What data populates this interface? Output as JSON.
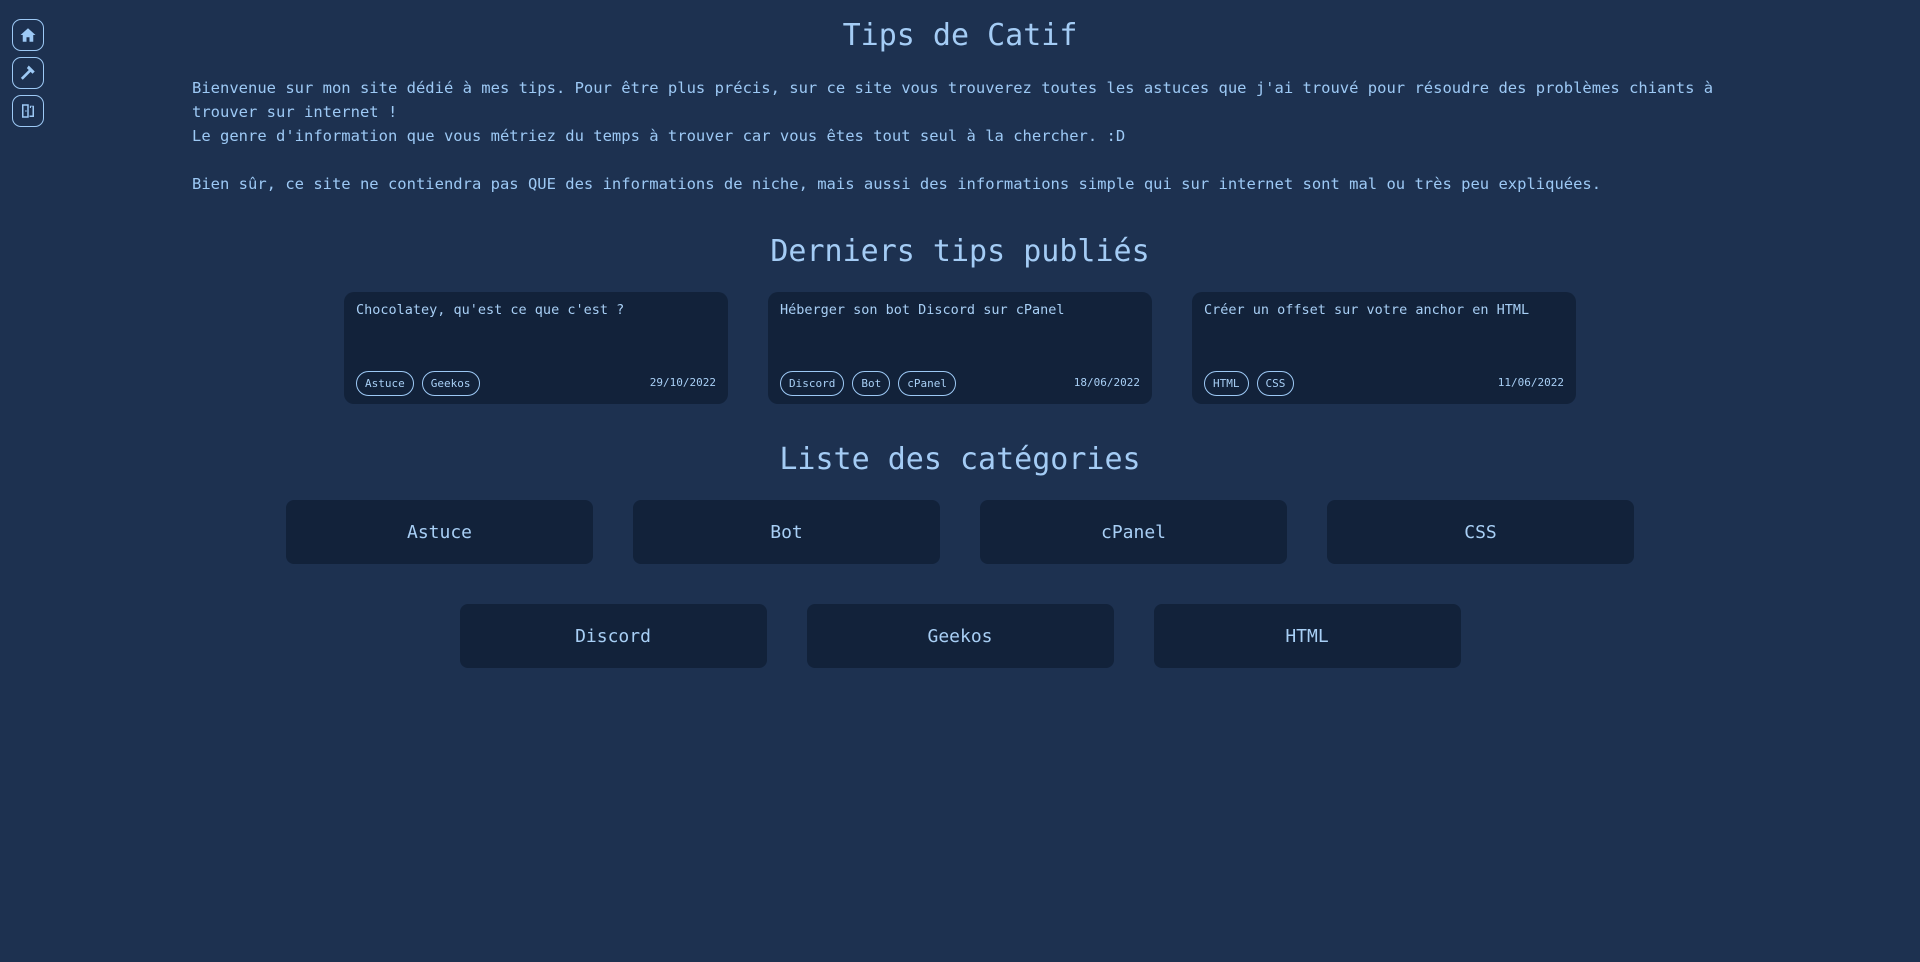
{
  "sidebar": {
    "items": [
      {
        "icon": "home-icon"
      },
      {
        "icon": "hammer-icon"
      },
      {
        "icon": "exit-door-icon"
      }
    ]
  },
  "header": {
    "title": "Tips de Catif"
  },
  "intro": {
    "line1": "Bienvenue sur mon site dédié à mes tips. Pour être plus précis, sur ce site vous trouverez toutes les astuces que j'ai trouvé pour résoudre des problèmes chiants à trouver sur internet !",
    "line2": "Le genre d'information que vous métriez du temps à trouver car vous êtes tout seul à la chercher. :D",
    "line3": "Bien sûr, ce site ne contiendra pas QUE des informations de niche, mais aussi des informations simple qui sur internet sont mal ou très peu expliquées."
  },
  "recent": {
    "title": "Derniers tips publiés",
    "tips": [
      {
        "title": "Chocolatey, qu'est ce que c'est ?",
        "tags": [
          "Astuce",
          "Geekos"
        ],
        "date": "29/10/2022"
      },
      {
        "title": "Héberger son bot Discord sur cPanel",
        "tags": [
          "Discord",
          "Bot",
          "cPanel"
        ],
        "date": "18/06/2022"
      },
      {
        "title": "Créer un offset sur votre anchor en HTML",
        "tags": [
          "HTML",
          "CSS"
        ],
        "date": "11/06/2022"
      }
    ]
  },
  "categories": {
    "title": "Liste des catégories",
    "items": [
      "Astuce",
      "Bot",
      "cPanel",
      "CSS",
      "Discord",
      "Geekos",
      "HTML"
    ]
  },
  "colors": {
    "background": "#1d3150",
    "card": "#12223a",
    "text": "#9dc9f5"
  }
}
